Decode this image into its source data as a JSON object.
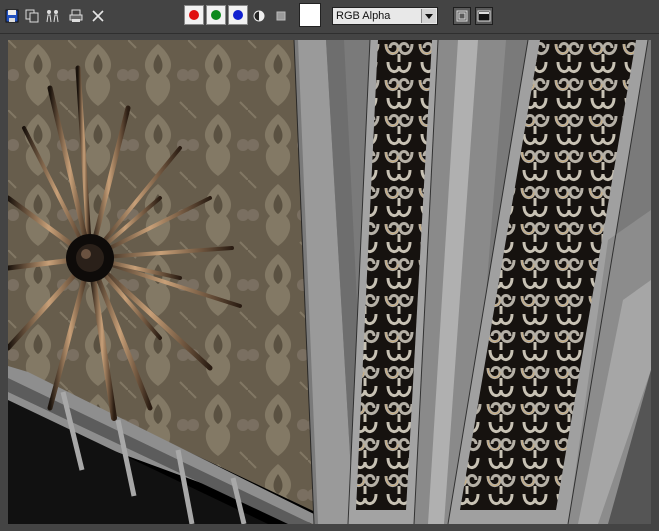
{
  "toolbar": {
    "icons": [
      "save-icon",
      "copy-icon",
      "clone-icon",
      "print-icon",
      "clear-icon"
    ],
    "channels": [
      {
        "name": "red-channel",
        "color": "#e01010"
      },
      {
        "name": "green-channel",
        "color": "#0c8a1c"
      },
      {
        "name": "blue-channel",
        "color": "#1020d0"
      }
    ],
    "mono_icon": "half-circle-icon",
    "alpha_icon": "square-icon",
    "display_channel": {
      "selected": "RGB Alpha"
    },
    "view_buttons": [
      "frame-window-icon",
      "display-icon"
    ]
  },
  "colors": {
    "ui_bg": "#444444",
    "wallpaper": "#6b6150",
    "panel": "#8e8e8e",
    "dark_grille": "#1a1613"
  }
}
